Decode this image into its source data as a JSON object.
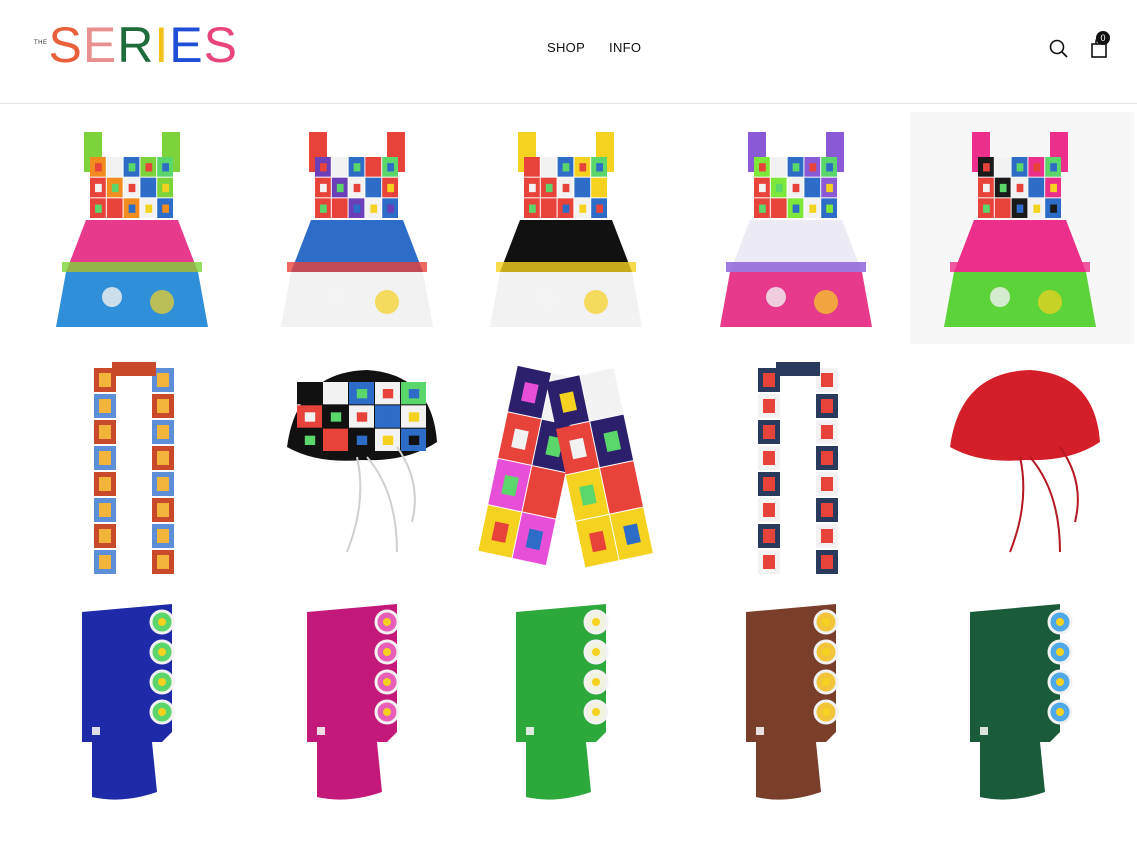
{
  "header": {
    "logo": {
      "prefix": "THE",
      "letters": [
        {
          "char": "S",
          "color": "#e8603c"
        },
        {
          "char": "E",
          "color": "#e88f8f"
        },
        {
          "char": "R",
          "color": "#1e6b3c"
        },
        {
          "char": "I",
          "color": "#f2c21b"
        },
        {
          "char": "E",
          "color": "#1f4fd6"
        },
        {
          "char": "S",
          "color": "#e8457a"
        }
      ]
    },
    "nav": [
      {
        "label": "SHOP"
      },
      {
        "label": "INFO"
      }
    ],
    "cart_count": "0",
    "icons": [
      "search-icon",
      "shopping-bag-icon"
    ]
  },
  "products": [
    {
      "kind": "dress",
      "top": "#f28c1f",
      "skirt": "#e73a8c",
      "hem": "#2f8fd8",
      "accent": "#7dd33a"
    },
    {
      "kind": "dress",
      "top": "#6b3fb8",
      "skirt": "#2d6cc7",
      "hem": "#f2f2f2",
      "accent": "#e8433b"
    },
    {
      "kind": "dress",
      "top": "#e8433b",
      "skirt": "#111111",
      "hem": "#f2f2f2",
      "accent": "#f5d21f"
    },
    {
      "kind": "dress",
      "top": "#7ee83a",
      "skirt": "#eceaf4",
      "hem": "#e73a8c",
      "accent": "#8a5ad6"
    },
    {
      "kind": "dress",
      "top": "#1a1a1a",
      "skirt": "#ec2f8a",
      "hem": "#5dd33a",
      "accent": "#ec2f8a"
    },
    {
      "kind": "scarf",
      "main": "#c94a2b",
      "alt": "#5c8fd8",
      "accent": "#f2b43a"
    },
    {
      "kind": "bonnet",
      "main": "#111111",
      "alt": "#f2f2f2",
      "tie": "#cfcfcf"
    },
    {
      "kind": "wide-scarf",
      "main": "#2c1f6b",
      "alt": "#f5d21f",
      "accent": "#e84fd8"
    },
    {
      "kind": "scarf",
      "main": "#2a3a5c",
      "alt": "#f2f2f2",
      "accent": "#e8433b"
    },
    {
      "kind": "bonnet",
      "main": "#d41f2a",
      "alt": "#b51822",
      "tie": "#b51822"
    },
    {
      "kind": "balaclava",
      "main": "#1e2aa8",
      "flower": "#5ad66b"
    },
    {
      "kind": "balaclava",
      "main": "#c2197a",
      "flower": "#e85fb8"
    },
    {
      "kind": "balaclava",
      "main": "#2da83a",
      "flower": "#f2f2e0"
    },
    {
      "kind": "balaclava",
      "main": "#7a3f2a",
      "flower": "#f2c43a"
    },
    {
      "kind": "balaclava",
      "main": "#1a5c3a",
      "flower": "#4fa8e8"
    }
  ]
}
